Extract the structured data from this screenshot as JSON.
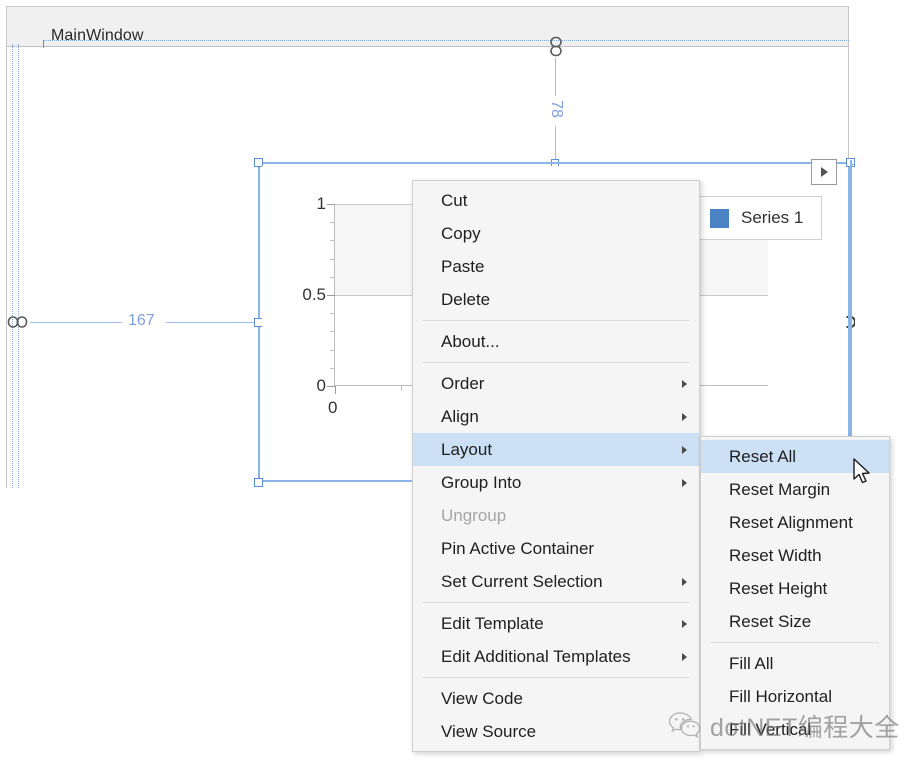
{
  "designer": {
    "window_title": "MainWindow",
    "margins": {
      "top_label": "78",
      "left_label": "167"
    },
    "icons": {
      "top_chain": "chain-link-icon",
      "left_chain": "chain-link-icon",
      "right_chain": "chain-link-broken-icon",
      "expander": "chevron-right-icon"
    }
  },
  "chart_data": {
    "type": "bar",
    "title": "",
    "xlabel": "",
    "ylabel": "",
    "categories": [
      "0"
    ],
    "values": [],
    "series": [
      {
        "name": "Series 1",
        "color": "#4b82c3",
        "values": []
      }
    ],
    "ylim": [
      0,
      1
    ],
    "yticks": [
      "0",
      "0.5",
      "1"
    ],
    "xticks": [
      "0"
    ],
    "grid": true,
    "legend_position": "top-right"
  },
  "legend": {
    "label": "Series 1",
    "color": "#4b82c3"
  },
  "context_menu": {
    "items": [
      {
        "label": "Cut",
        "submenu": false,
        "disabled": false,
        "separator_after": false
      },
      {
        "label": "Copy",
        "submenu": false,
        "disabled": false,
        "separator_after": false
      },
      {
        "label": "Paste",
        "submenu": false,
        "disabled": false,
        "separator_after": false
      },
      {
        "label": "Delete",
        "submenu": false,
        "disabled": false,
        "separator_after": true
      },
      {
        "label": "About...",
        "submenu": false,
        "disabled": false,
        "separator_after": true
      },
      {
        "label": "Order",
        "submenu": true,
        "disabled": false,
        "separator_after": false
      },
      {
        "label": "Align",
        "submenu": true,
        "disabled": false,
        "separator_after": false
      },
      {
        "label": "Layout",
        "submenu": true,
        "disabled": false,
        "separator_after": false,
        "highlighted": true
      },
      {
        "label": "Group Into",
        "submenu": true,
        "disabled": false,
        "separator_after": false
      },
      {
        "label": "Ungroup",
        "submenu": false,
        "disabled": true,
        "separator_after": false
      },
      {
        "label": "Pin Active Container",
        "submenu": false,
        "disabled": false,
        "separator_after": false
      },
      {
        "label": "Set Current Selection",
        "submenu": true,
        "disabled": false,
        "separator_after": true
      },
      {
        "label": "Edit Template",
        "submenu": true,
        "disabled": false,
        "separator_after": false
      },
      {
        "label": "Edit Additional Templates",
        "submenu": true,
        "disabled": false,
        "separator_after": true
      },
      {
        "label": "View Code",
        "submenu": false,
        "disabled": false,
        "separator_after": false
      },
      {
        "label": "View Source",
        "submenu": false,
        "disabled": false,
        "separator_after": false
      }
    ]
  },
  "layout_submenu": {
    "items": [
      {
        "label": "Reset All",
        "highlighted": true,
        "separator_after": false
      },
      {
        "label": "Reset Margin",
        "highlighted": false,
        "separator_after": false
      },
      {
        "label": "Reset Alignment",
        "highlighted": false,
        "separator_after": false
      },
      {
        "label": "Reset Width",
        "highlighted": false,
        "separator_after": false
      },
      {
        "label": "Reset Height",
        "highlighted": false,
        "separator_after": false
      },
      {
        "label": "Reset Size",
        "highlighted": false,
        "separator_after": true
      },
      {
        "label": "Fill All",
        "highlighted": false,
        "separator_after": false
      },
      {
        "label": "Fill Horizontal",
        "highlighted": false,
        "separator_after": false
      },
      {
        "label": "Fill Vertical",
        "highlighted": false,
        "separator_after": false
      }
    ]
  },
  "watermark": {
    "text": "dotNET编程大全",
    "icon": "wechat-icon"
  },
  "colors": {
    "selection": "#8ab4e8",
    "margin": "#9cbff0",
    "menu_highlight": "#cce0f5",
    "series": "#4b82c3"
  }
}
